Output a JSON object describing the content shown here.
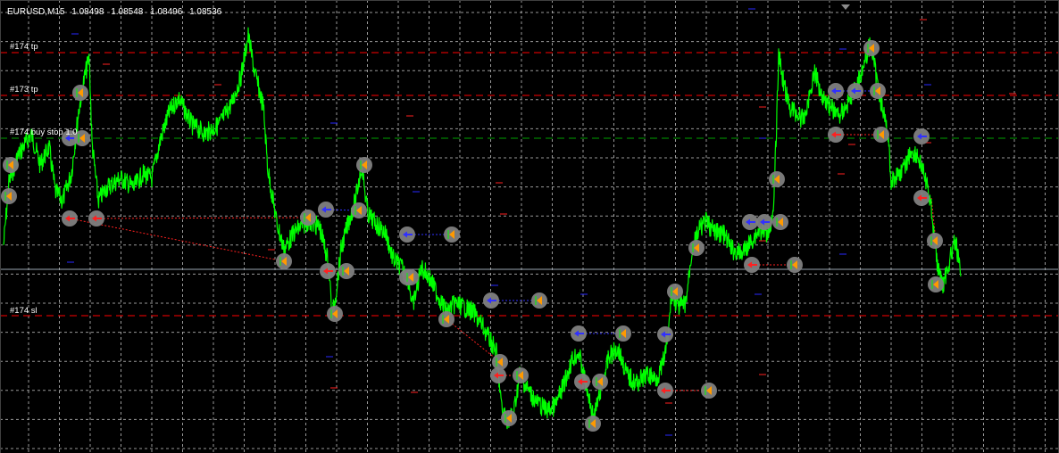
{
  "header": {
    "symbol": "EURUSD,M15",
    "open": "1.08498",
    "high": "1.08548",
    "low": "1.08496",
    "close": "1.08536"
  },
  "levels": [
    {
      "label": "#174 tp",
      "style": "red-dash"
    },
    {
      "label": "#173 tp",
      "style": "red-dash"
    },
    {
      "label": "#174 buy stop 1.0",
      "style": "green-dash"
    },
    {
      "label": "#174 sl",
      "style": "red-dash"
    }
  ],
  "colors": {
    "background": "#000000",
    "grid": "#b4b4b4",
    "price": "#00ff00",
    "tp_sl_line": "#ff0000",
    "pending_line": "#00a000",
    "bid_line": "#9aa6b2",
    "buy_marker": "#3030ff",
    "sell_marker": "#ff2020",
    "close_marker": "#ff9900",
    "marker_halo": "#808080"
  },
  "icons": {
    "buy_arrow": "buy-arrow-icon",
    "sell_arrow": "sell-arrow-icon",
    "close_arrow": "close-arrow-icon",
    "chart_shift": "chart-shift-triangle-icon"
  }
}
